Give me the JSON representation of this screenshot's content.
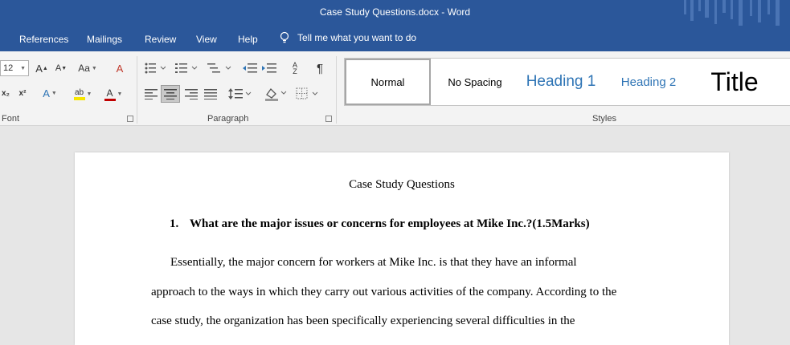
{
  "window": {
    "title": "Case Study Questions.docx  -  Word"
  },
  "tabs": [
    "References",
    "Mailings",
    "Review",
    "View",
    "Help"
  ],
  "tell_me": {
    "label": "Tell me what you want to do"
  },
  "ribbon": {
    "font_size": "12",
    "font_group_label": "Font",
    "paragraph_group_label": "Paragraph",
    "styles_group_label": "Styles",
    "styles": [
      "Normal",
      "No Spacing",
      "Heading 1",
      "Heading 2",
      "Title"
    ],
    "selected_style": "Normal"
  },
  "document": {
    "title": "Case Study Questions",
    "question": {
      "number": "1.",
      "text": "What are the major issues or concerns for employees at Mike Inc.?(1.5Marks)"
    },
    "paragraph_lines": [
      "Essentially, the major concern for workers at Mike Inc. is that they have an informal",
      "approach to the ways in which they carry out various activities of the company. According to the",
      "case study, the organization has been specifically experiencing several difficulties in the"
    ]
  },
  "colors": {
    "title_bar": "#2b579a",
    "ribbon_bg": "#f3f3f3",
    "workspace_bg": "#e6e6e6",
    "highlight": "#f7e600",
    "font_color": "#c00000",
    "heading_blue": "#2e74b5"
  }
}
